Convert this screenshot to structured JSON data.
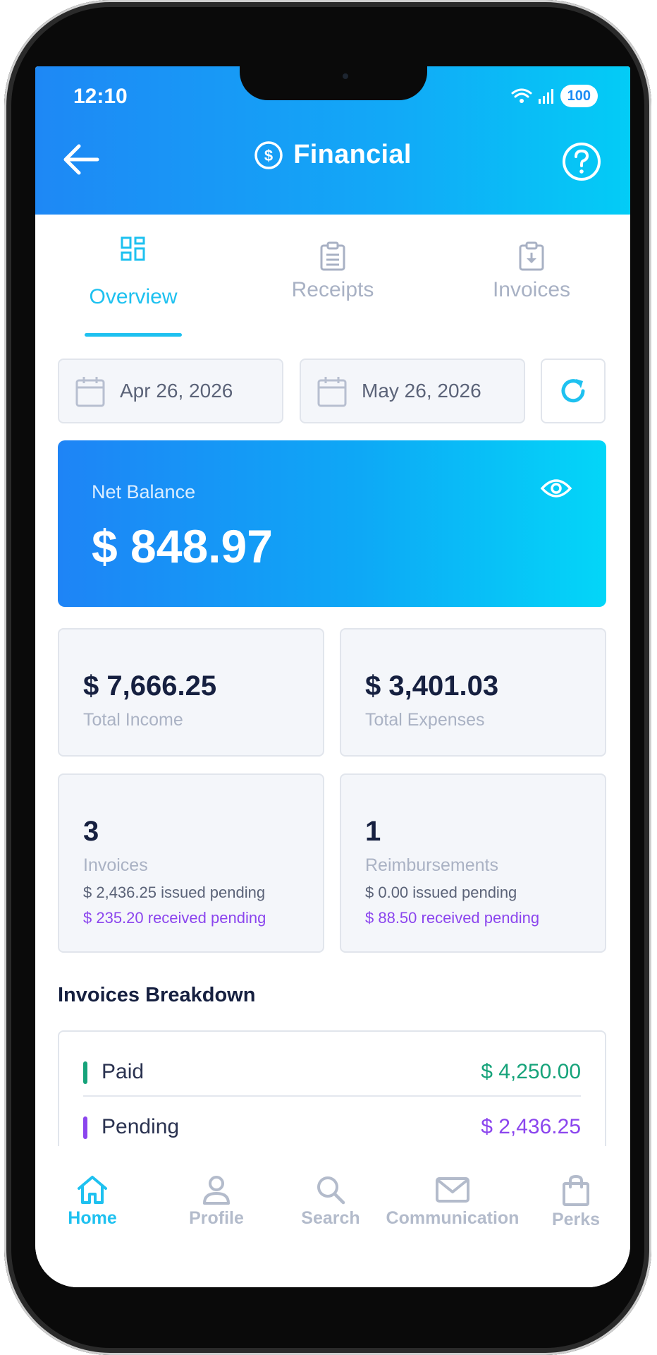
{
  "status_bar": {
    "time": "12:10",
    "battery": "100"
  },
  "header": {
    "title": "Financial"
  },
  "tabs": [
    {
      "label": "Overview",
      "active": true,
      "icon": "grid-icon"
    },
    {
      "label": "Receipts",
      "active": false,
      "icon": "clipboard-icon"
    },
    {
      "label": "Invoices",
      "active": false,
      "icon": "invoice-download-icon"
    }
  ],
  "date_range": {
    "start": "Apr 26, 2026",
    "end": "May 26, 2026"
  },
  "net_balance": {
    "label": "Net Balance",
    "value": "$ 848.97"
  },
  "totals": {
    "income": {
      "value": "$ 7,666.25",
      "label": "Total Income"
    },
    "expenses": {
      "value": "$ 3,401.03",
      "label": "Total Expenses"
    }
  },
  "invoices_card": {
    "count": "3",
    "label": "Invoices",
    "issued": "$ 2,436.25 issued pending",
    "received": "$ 235.20 received pending"
  },
  "reimbursements_card": {
    "count": "1",
    "label": "Reimbursements",
    "issued": "$ 0.00 issued pending",
    "received": "$ 88.50 received pending"
  },
  "breakdown": {
    "title": "Invoices Breakdown",
    "rows": [
      {
        "label": "Paid",
        "amount": "$ 4,250.00",
        "color": "#16a37a"
      },
      {
        "label": "Pending",
        "amount": "$ 2,436.25",
        "color": "#8b45ee"
      }
    ]
  },
  "bottom_nav": [
    {
      "label": "Home",
      "icon": "home-icon",
      "active": true
    },
    {
      "label": "Profile",
      "icon": "user-icon",
      "active": false
    },
    {
      "label": "Search",
      "icon": "search-icon",
      "active": false
    },
    {
      "label": "Communication",
      "icon": "mail-icon",
      "active": false
    },
    {
      "label": "Perks",
      "icon": "shopping-bag-icon",
      "active": false
    }
  ],
  "colors": {
    "accent": "#1ec1f0",
    "primary_text": "#162040",
    "muted": "#aab2c4",
    "pending_purple": "#8b45ee",
    "paid_green": "#16a37a"
  }
}
